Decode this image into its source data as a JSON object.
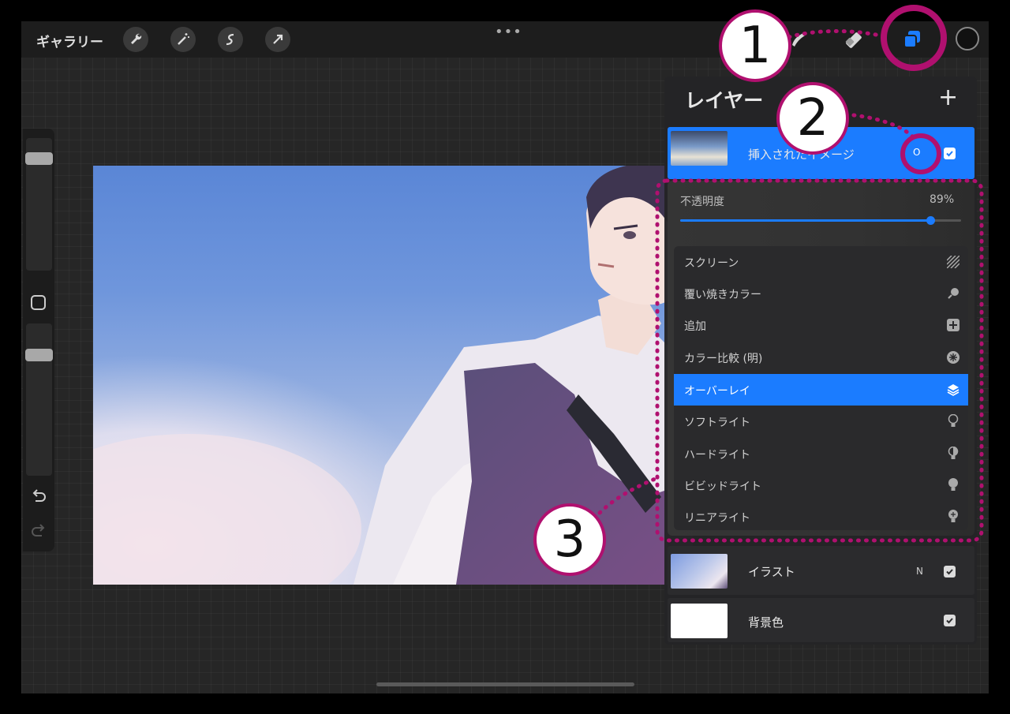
{
  "toolbar": {
    "gallery_label": "ギャラリー",
    "left_tools": [
      "wrench-icon",
      "magic-wand-icon",
      "selection-icon",
      "transform-arrow-icon"
    ],
    "center_menu": "•••",
    "right_tools": [
      "brush-icon",
      "smudge-icon",
      "eraser-icon",
      "layers-icon"
    ],
    "accent_color": "#1b7cff"
  },
  "sidebar": {
    "brush_size_level": 0.88,
    "opacity_level": 0.82,
    "modify_button_icon": "square-icon",
    "undo_icon": "undo-icon",
    "redo_icon": "redo-icon"
  },
  "layers_panel": {
    "title": "レイヤー",
    "add_label": "+",
    "layers": [
      {
        "name": "挿入されたイメージ",
        "mode": "O",
        "visible": true,
        "selected": true
      },
      {
        "name": "イラスト",
        "mode": "N",
        "visible": true,
        "selected": false
      },
      {
        "name": "背景色",
        "mode": "",
        "visible": true,
        "selected": false
      }
    ],
    "blend_popup": {
      "opacity_label": "不透明度",
      "opacity_value": "89%",
      "opacity_fraction": 0.89,
      "modes": [
        {
          "label": "スクリーン",
          "icon": "hatch-icon"
        },
        {
          "label": "覆い焼きカラー",
          "icon": "dodge-icon"
        },
        {
          "label": "追加",
          "icon": "plus-square-icon"
        },
        {
          "label": "カラー比較 (明)",
          "icon": "sparkle-icon"
        },
        {
          "label": "オーバーレイ",
          "icon": "layers-stack-icon",
          "active": true
        },
        {
          "label": "ソフトライト",
          "icon": "bulb-outline-icon"
        },
        {
          "label": "ハードライト",
          "icon": "bulb-half-icon"
        },
        {
          "label": "ビビッドライト",
          "icon": "bulb-filled-icon"
        },
        {
          "label": "リニアライト",
          "icon": "bulb-bright-icon"
        }
      ]
    }
  },
  "callouts": {
    "one": "1",
    "two": "2",
    "three": "3",
    "color": "#b0106f"
  }
}
